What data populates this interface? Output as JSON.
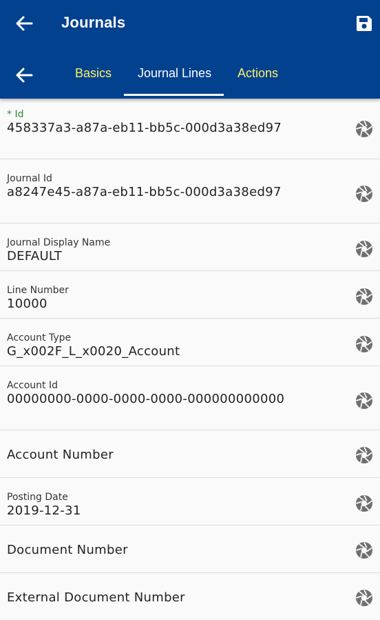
{
  "appbar": {
    "title": "Journals",
    "back_icon": "arrow-left-icon",
    "save_icon": "floppy-disk-icon"
  },
  "tabs": {
    "back_icon": "arrow-left-icon",
    "items": [
      {
        "label": "Basics",
        "active": false
      },
      {
        "label": "Journal Lines",
        "active": true
      },
      {
        "label": "Actions",
        "active": false
      }
    ],
    "active_color": "#ffffff",
    "inactive_color": "#fff06a"
  },
  "fields": [
    {
      "label": "* Id",
      "value": "458337a3-a87a-eb11-bb5c-000d3a38ed97"
    },
    {
      "label": "Journal Id",
      "value": "a8247e45-a87a-eb11-bb5c-000d3a38ed97"
    },
    {
      "label": "Journal Display Name",
      "value": "DEFAULT"
    },
    {
      "label": "Line Number",
      "value": "10000"
    },
    {
      "label": "Account Type",
      "value": "G_x002F_L_x0020_Account"
    },
    {
      "label": "Account Id",
      "value": "00000000-0000-0000-0000-000000000000"
    },
    {
      "label": "Account Number",
      "value": ""
    },
    {
      "label": "Posting Date",
      "value": "2019-12-31"
    },
    {
      "label": "Document Number",
      "value": ""
    },
    {
      "label": "External Document Number",
      "value": ""
    }
  ],
  "colors": {
    "primary": "#02418e",
    "accent": "#fff06a",
    "required": "#2e8b3a"
  },
  "field_icon": "aperture-icon"
}
